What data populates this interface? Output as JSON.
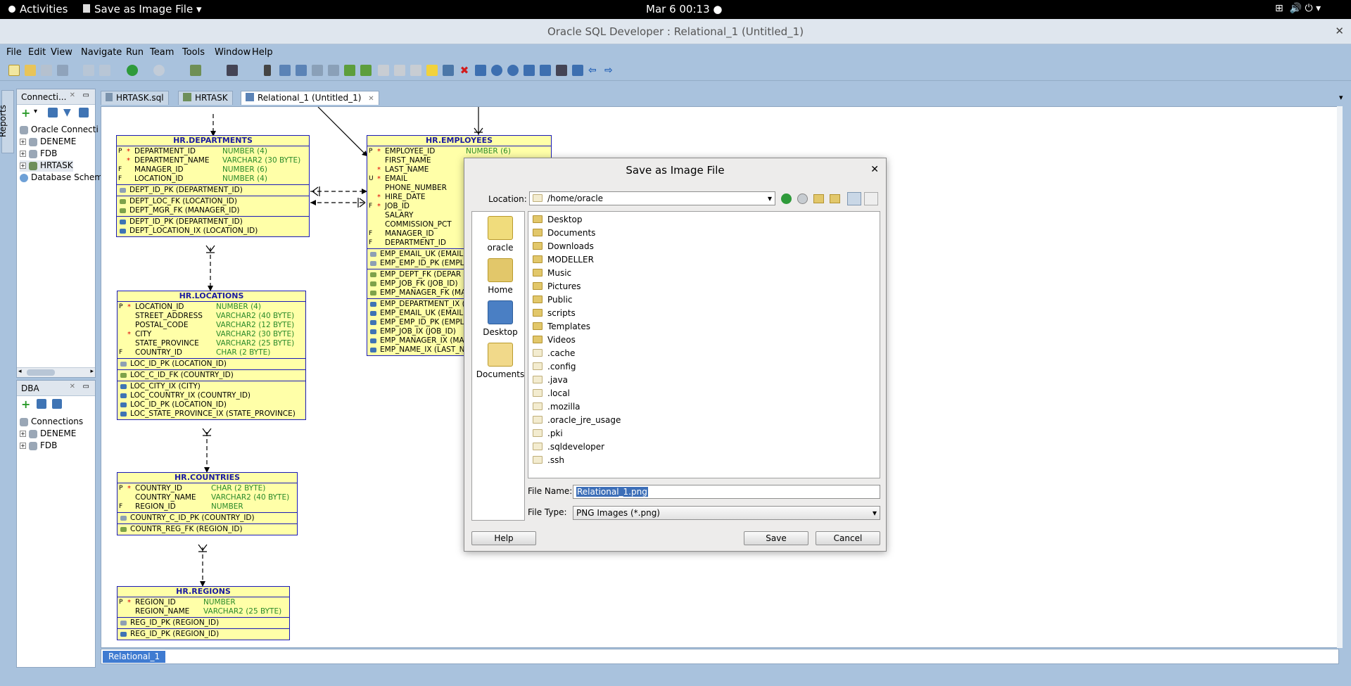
{
  "topbar": {
    "activities": "Activities",
    "app_menu": "Save as Image File",
    "clock": "Mar 6  00:13"
  },
  "window": {
    "title": "Oracle SQL Developer : Relational_1 (Untitled_1)"
  },
  "menu": [
    "File",
    "Edit",
    "View",
    "Navigate",
    "Run",
    "Team",
    "Tools",
    "Window",
    "Help"
  ],
  "side_tab": "Reports",
  "connections": {
    "title": "Connecti...",
    "items": [
      "Oracle Connecti",
      "DENEME",
      "FDB",
      "HRTASK",
      "Database Schem"
    ]
  },
  "dba": {
    "title": "DBA",
    "root": "Connections",
    "items": [
      "DENEME",
      "FDB"
    ]
  },
  "tabs": [
    "HRTASK.sql",
    "HRTASK",
    "Relational_1 (Untitled_1)"
  ],
  "bottom_tab": "Relational_1",
  "tables": {
    "departments": {
      "name": "HR.DEPARTMENTS",
      "cols": [
        [
          "P",
          "*",
          "DEPARTMENT_ID",
          "NUMBER (4)"
        ],
        [
          "",
          "*",
          "DEPARTMENT_NAME",
          "VARCHAR2 (30 BYTE)"
        ],
        [
          "F",
          "",
          "MANAGER_ID",
          "NUMBER (6)"
        ],
        [
          "F",
          "",
          "LOCATION_ID",
          "NUMBER (4)"
        ]
      ],
      "pk": [
        "DEPT_ID_PK (DEPARTMENT_ID)"
      ],
      "fk": [
        "DEPT_LOC_FK (LOCATION_ID)",
        "DEPT_MGR_FK (MANAGER_ID)"
      ],
      "ix": [
        "DEPT_ID_PK (DEPARTMENT_ID)",
        "DEPT_LOCATION_IX (LOCATION_ID)"
      ]
    },
    "employees": {
      "name": "HR.EMPLOYEES",
      "cols": [
        [
          "P",
          "*",
          "EMPLOYEE_ID",
          "NUMBER (6)"
        ],
        [
          "",
          "",
          "FIRST_NAME",
          ""
        ],
        [
          "",
          "*",
          "LAST_NAME",
          ""
        ],
        [
          "U",
          "*",
          "EMAIL",
          ""
        ],
        [
          "",
          "",
          "PHONE_NUMBER",
          ""
        ],
        [
          "",
          "*",
          "HIRE_DATE",
          ""
        ],
        [
          "F",
          "*",
          "JOB_ID",
          ""
        ],
        [
          "",
          "",
          "SALARY",
          ""
        ],
        [
          "",
          "",
          "COMMISSION_PCT",
          ""
        ],
        [
          "F",
          "",
          "MANAGER_ID",
          ""
        ],
        [
          "F",
          "",
          "DEPARTMENT_ID",
          ""
        ]
      ],
      "pk": [
        "EMP_EMAIL_UK (EMAIL)",
        "EMP_EMP_ID_PK (EMPL"
      ],
      "fk": [
        "EMP_DEPT_FK (DEPAR",
        "EMP_JOB_FK (JOB_ID)",
        "EMP_MANAGER_FK (MA"
      ],
      "ix": [
        "EMP_DEPARTMENT_IX (",
        "EMP_EMAIL_UK (EMAIL)",
        "EMP_EMP_ID_PK (EMPL",
        "EMP_JOB_IX (JOB_ID)",
        "EMP_MANAGER_IX (MAN",
        "EMP_NAME_IX (LAST_NA"
      ]
    },
    "locations": {
      "name": "HR.LOCATIONS",
      "cols": [
        [
          "P",
          "*",
          "LOCATION_ID",
          "NUMBER (4)"
        ],
        [
          "",
          "",
          "STREET_ADDRESS",
          "VARCHAR2 (40 BYTE)"
        ],
        [
          "",
          "",
          "POSTAL_CODE",
          "VARCHAR2 (12 BYTE)"
        ],
        [
          "",
          "*",
          "CITY",
          "VARCHAR2 (30 BYTE)"
        ],
        [
          "",
          "",
          "STATE_PROVINCE",
          "VARCHAR2 (25 BYTE)"
        ],
        [
          "F",
          "",
          "COUNTRY_ID",
          "CHAR (2 BYTE)"
        ]
      ],
      "pk": [
        "LOC_ID_PK (LOCATION_ID)"
      ],
      "fk": [
        "LOC_C_ID_FK (COUNTRY_ID)"
      ],
      "ix": [
        "LOC_CITY_IX (CITY)",
        "LOC_COUNTRY_IX (COUNTRY_ID)",
        "LOC_ID_PK (LOCATION_ID)",
        "LOC_STATE_PROVINCE_IX (STATE_PROVINCE)"
      ]
    },
    "countries": {
      "name": "HR.COUNTRIES",
      "cols": [
        [
          "P",
          "*",
          "COUNTRY_ID",
          "CHAR (2 BYTE)"
        ],
        [
          "",
          "",
          "COUNTRY_NAME",
          "VARCHAR2 (40 BYTE)"
        ],
        [
          "F",
          "",
          "REGION_ID",
          "NUMBER"
        ]
      ],
      "pk": [
        "COUNTRY_C_ID_PK (COUNTRY_ID)"
      ],
      "fk": [
        "COUNTR_REG_FK (REGION_ID)"
      ],
      "ix": []
    },
    "regions": {
      "name": "HR.REGIONS",
      "cols": [
        [
          "P",
          "*",
          "REGION_ID",
          "NUMBER"
        ],
        [
          "",
          "",
          "REGION_NAME",
          "VARCHAR2 (25 BYTE)"
        ]
      ],
      "pk": [
        "REG_ID_PK (REGION_ID)"
      ],
      "fk": [],
      "ix": [
        "REG_ID_PK (REGION_ID)"
      ]
    }
  },
  "dialog": {
    "title": "Save as Image File",
    "location_label": "Location:",
    "location": "/home/oracle",
    "places": [
      "oracle",
      "Home",
      "Desktop",
      "Documents"
    ],
    "files": [
      "Desktop",
      "Documents",
      "Downloads",
      "MODELLER",
      "Music",
      "Pictures",
      "Public",
      "scripts",
      "Templates",
      "Videos",
      ".cache",
      ".config",
      ".java",
      ".local",
      ".mozilla",
      ".oracle_jre_usage",
      ".pki",
      ".sqldeveloper",
      ".ssh"
    ],
    "file_name_label": "File Name:",
    "file_name": "Relational_1.png",
    "file_type_label": "File Type:",
    "file_type": "PNG Images (*.png)",
    "help": "Help",
    "save": "Save",
    "cancel": "Cancel"
  }
}
